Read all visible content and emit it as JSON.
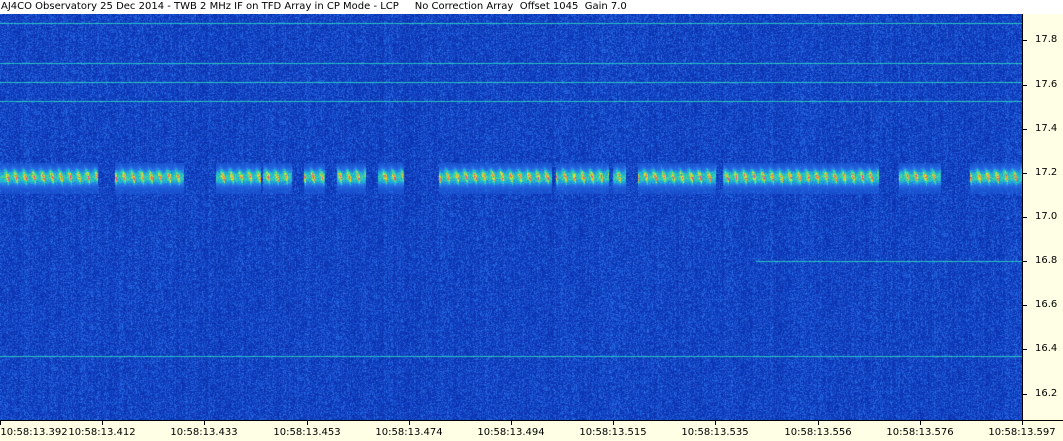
{
  "window": {
    "title": "AJ4CO Observatory 25 Dec 2014 - TWB 2 MHz IF on TFD Array in CP Mode - LCP     No Correction Array  Offset 1045  Gain 7.0"
  },
  "colors": {
    "background": "#0c3ca8",
    "axis_background": "#ffffe6",
    "signal_low": "#18b4c8",
    "signal_mid": "#f0e628",
    "signal_high": "#e85078"
  },
  "chart_data": {
    "type": "heatmap",
    "title": "",
    "xlabel": "",
    "ylabel": "",
    "x_ticks": [
      "10:58:13.392",
      "10:58:13.412",
      "10:58:13.433",
      "10:58:13.453",
      "10:58:13.474",
      "10:58:13.494",
      "10:58:13.515",
      "10:58:13.535",
      "10:58:13.556",
      "10:58:13.576",
      "10:58:13.597"
    ],
    "y_ticks": [
      "17.8",
      "17.6",
      "17.4",
      "17.2",
      "17.0",
      "16.8",
      "16.6",
      "16.4",
      "16.2"
    ],
    "y_tick_values": [
      17.8,
      17.6,
      17.4,
      17.2,
      17.0,
      16.8,
      16.6,
      16.4,
      16.2
    ],
    "xlim": [
      "10:58:13.392",
      "10:58:13.597"
    ],
    "ylim": [
      16.08,
      17.92
    ],
    "emission_band": {
      "center_mhz": 17.18,
      "segments_seconds": [
        [
          0.0,
          0.095
        ],
        [
          0.113,
          0.18
        ],
        [
          0.212,
          0.255
        ],
        [
          0.258,
          0.285
        ],
        [
          0.298,
          0.318
        ],
        [
          0.33,
          0.358
        ],
        [
          0.37,
          0.395
        ],
        [
          0.43,
          0.456
        ],
        [
          0.457,
          0.48
        ],
        [
          0.48,
          0.54
        ],
        [
          0.545,
          0.595
        ],
        [
          0.6,
          0.612
        ],
        [
          0.625,
          0.7
        ],
        [
          0.708,
          0.77
        ],
        [
          0.771,
          0.86
        ],
        [
          0.88,
          0.92
        ],
        [
          0.95,
          1.0
        ]
      ]
    },
    "horizontal_lines": [
      {
        "freq_mhz": 17.88,
        "start": 0.0,
        "end": 1.0
      },
      {
        "freq_mhz": 17.7,
        "start": 0.0,
        "end": 1.0
      },
      {
        "freq_mhz": 17.61,
        "start": 0.0,
        "end": 1.0
      },
      {
        "freq_mhz": 17.525,
        "start": 0.0,
        "end": 1.0
      },
      {
        "freq_mhz": 16.8,
        "start": 0.74,
        "end": 1.0
      },
      {
        "freq_mhz": 16.37,
        "start": 0.0,
        "end": 1.0
      }
    ]
  }
}
